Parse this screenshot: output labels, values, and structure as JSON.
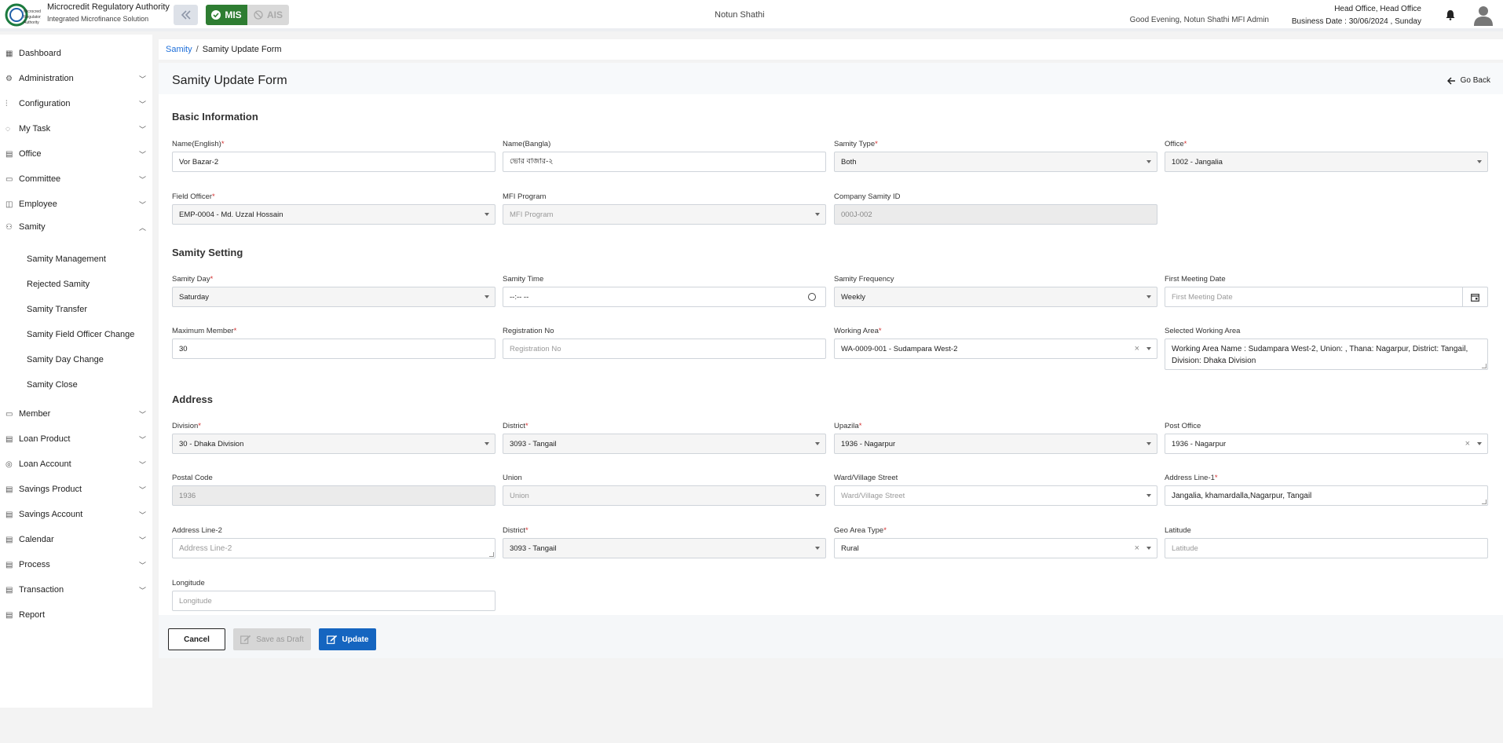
{
  "header": {
    "brand_title": "Microcredit Regulatory Authority",
    "brand_subtitle": "Integrated Microfinance Solution",
    "logo_text": "Microcredit Regulatory Authority",
    "mis_label": "MIS",
    "ais_label": "AIS",
    "app_name": "Notun Shathi",
    "greeting": "Good Evening, Notun Shathi MFI Admin",
    "office": "Head Office, Head Office",
    "business_date": "Business Date : 30/06/2024 , Sunday"
  },
  "sidebar": {
    "items": [
      {
        "label": "Dashboard",
        "icon": "grid-icon"
      },
      {
        "label": "Administration",
        "icon": "admin-icon"
      },
      {
        "label": "Configuration",
        "icon": "sliders-icon"
      },
      {
        "label": "My Task",
        "icon": "task-icon"
      },
      {
        "label": "Office",
        "icon": "office-icon"
      },
      {
        "label": "Committee",
        "icon": "committee-icon"
      },
      {
        "label": "Employee",
        "icon": "employee-icon"
      },
      {
        "label": "Samity",
        "icon": "samity-icon"
      },
      {
        "label": "Member",
        "icon": "member-icon"
      },
      {
        "label": "Loan Product",
        "icon": "document-icon"
      },
      {
        "label": "Loan Account",
        "icon": "loan-account-icon"
      },
      {
        "label": "Savings Product",
        "icon": "document-icon"
      },
      {
        "label": "Savings Account",
        "icon": "document-icon"
      },
      {
        "label": "Calendar",
        "icon": "document-icon"
      },
      {
        "label": "Process",
        "icon": "document-icon"
      },
      {
        "label": "Transaction",
        "icon": "document-icon"
      },
      {
        "label": "Report",
        "icon": "document-icon"
      }
    ],
    "samity_sub": [
      "Samity Management",
      "Rejected Samity",
      "Samity Transfer",
      "Samity Field Officer Change",
      "Samity Day Change",
      "Samity Close"
    ]
  },
  "breadcrumb": {
    "parent": "Samity",
    "separator": "/",
    "current": "Samity Update Form"
  },
  "page": {
    "title": "Samity Update Form",
    "go_back": "Go Back"
  },
  "sections": {
    "basic": "Basic Information",
    "setting": "Samity Setting",
    "address": "Address"
  },
  "fields": {
    "name_en": {
      "label": "Name(English)",
      "value": "Vor Bazar-2"
    },
    "name_bn": {
      "label": "Name(Bangla)",
      "value": "ভোর বাজার-২"
    },
    "samity_type": {
      "label": "Samity Type",
      "value": "Both"
    },
    "office": {
      "label": "Office",
      "value": "1002 - Jangalia"
    },
    "field_officer": {
      "label": "Field Officer",
      "value": "EMP-0004 - Md. Uzzal Hossain"
    },
    "mfi_program": {
      "label": "MFI Program",
      "placeholder": "MFI Program"
    },
    "company_samity_id": {
      "label": "Company Samity ID",
      "value": "000J-002"
    },
    "samity_day": {
      "label": "Samity Day",
      "value": "Saturday"
    },
    "samity_time": {
      "label": "Samity Time",
      "value": "--:-- --"
    },
    "samity_frequency": {
      "label": "Samity Frequency",
      "value": "Weekly"
    },
    "first_meeting_date": {
      "label": "First Meeting Date",
      "placeholder": "First Meeting Date"
    },
    "max_member": {
      "label": "Maximum Member",
      "value": "30"
    },
    "registration_no": {
      "label": "Registration No",
      "placeholder": "Registration No"
    },
    "working_area": {
      "label": "Working Area",
      "value": "WA-0009-001 - Sudampara West-2"
    },
    "selected_working_area": {
      "label": "Selected Working Area",
      "value": "Working Area Name : Sudampara West-2, Union: , Thana:  Nagarpur, District: Tangail, Division: Dhaka Division"
    },
    "division": {
      "label": "Division",
      "value": "30 - Dhaka Division"
    },
    "district": {
      "label": "District",
      "value": "3093 - Tangail"
    },
    "upazila": {
      "label": "Upazila",
      "value": "1936 - Nagarpur"
    },
    "post_office": {
      "label": "Post Office",
      "value": "1936 - Nagarpur"
    },
    "postal_code": {
      "label": "Postal Code",
      "value": "1936"
    },
    "union": {
      "label": "Union",
      "placeholder": "Union"
    },
    "ward": {
      "label": "Ward/Village Street",
      "placeholder": "Ward/Village Street"
    },
    "address1": {
      "label": "Address Line-1",
      "value": "Jangalia, khamardalla,Nagarpur, Tangail"
    },
    "address2": {
      "label": "Address Line-2",
      "placeholder": "Address Line-2"
    },
    "district2": {
      "label": "District",
      "value": "3093 - Tangail"
    },
    "geo_area_type": {
      "label": "Geo Area Type",
      "value": "Rural"
    },
    "latitude": {
      "label": "Latitude",
      "placeholder": "Latitude"
    },
    "longitude": {
      "label": "Longitude",
      "placeholder": "Longitude"
    }
  },
  "buttons": {
    "cancel": "Cancel",
    "save_draft": "Save as Draft",
    "update": "Update"
  },
  "colors": {
    "accent": "#1565c0",
    "mis_green": "#2e7d32",
    "required": "#d32f2f"
  }
}
